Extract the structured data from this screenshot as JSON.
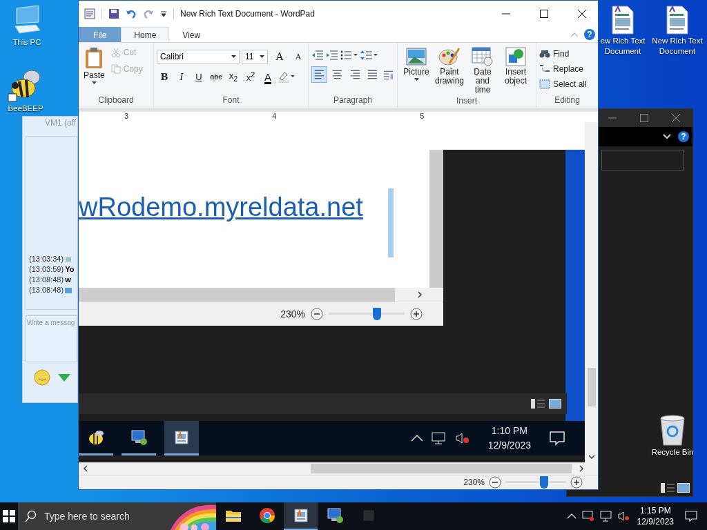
{
  "desktop": {
    "icons": [
      {
        "kind": "pc",
        "label": "This PC"
      },
      {
        "kind": "bee",
        "label": "BeeBEEP"
      },
      {
        "kind": "doc",
        "label": "ew Rich Text Document"
      },
      {
        "kind": "doc",
        "label": "New Rich Text Document"
      },
      {
        "kind": "bin",
        "label": "Recycle Bin"
      }
    ]
  },
  "chat_window": {
    "title": "VM1 (off",
    "messages": [
      {
        "kind": "icon",
        "time": "(13:03:34)"
      },
      {
        "kind": "text",
        "time": "(13:03:59)",
        "text": "Yo"
      },
      {
        "kind": "text",
        "time": "(13:08:48)",
        "text": "w"
      },
      {
        "kind": "mail",
        "time": "(13:08:48)"
      }
    ],
    "input": {
      "placeholder": "Write a messag"
    }
  },
  "explorer_window": {
    "help": "?"
  },
  "wordpad": {
    "title": "New Rich Text Document - WordPad",
    "help": "?",
    "tabs": [
      {
        "kind": "file",
        "label": "File",
        "selected": false
      },
      {
        "kind": "tab",
        "label": "Home",
        "selected": true
      },
      {
        "kind": "tab",
        "label": "View",
        "selected": false
      }
    ],
    "ribbon": {
      "clipboard": {
        "label": "Clipboard",
        "paste": "Paste",
        "items": [
          {
            "kind": "cut",
            "label": "Cut",
            "disabled": true
          },
          {
            "kind": "copy",
            "label": "Copy",
            "disabled": true
          }
        ]
      },
      "font": {
        "label": "Font",
        "family": "Calibri",
        "size": "11",
        "size_buttons": [
          {
            "kind": "grow",
            "label": "A"
          },
          {
            "kind": "shrink",
            "label": "A"
          }
        ],
        "format_buttons": [
          {
            "kind": "bold",
            "label": "B"
          },
          {
            "kind": "italic",
            "label": "I"
          },
          {
            "kind": "underline",
            "label": "U"
          },
          {
            "kind": "strike",
            "label": "abc"
          },
          {
            "kind": "sub",
            "label": "x$_{2}$"
          },
          {
            "kind": "sup",
            "label": "x$^{2}$"
          },
          {
            "kind": "color",
            "label": "A"
          },
          {
            "kind": "highlight"
          }
        ]
      },
      "paragraph": {
        "label": "Paragraph",
        "alignments": [
          {
            "kind": "left",
            "selected": true
          },
          {
            "kind": "center",
            "selected": false
          },
          {
            "kind": "right",
            "selected": false
          },
          {
            "kind": "justify",
            "selected": false
          }
        ]
      },
      "insert": {
        "label": "Insert",
        "items": [
          {
            "kind": "picture",
            "label": "Picture"
          },
          {
            "kind": "paint",
            "label": "Paint drawing"
          },
          {
            "kind": "datetime",
            "label": "Date and time"
          },
          {
            "kind": "object",
            "label": "Insert object"
          }
        ]
      },
      "editing": {
        "label": "Editing",
        "items": [
          {
            "kind": "find",
            "label": "Find"
          },
          {
            "kind": "replace",
            "label": "Replace"
          },
          {
            "kind": "select",
            "label": "Select all"
          }
        ]
      }
    },
    "ruler": [
      "3",
      "4",
      "5"
    ],
    "screenshot": {
      "link": "wRodemo.myreldata.net",
      "zoom": "230%",
      "level": 0.64,
      "taskbar": {
        "apps": [
          {
            "kind": "bee",
            "selected": false
          },
          {
            "kind": "remote",
            "selected": false
          },
          {
            "kind": "wordpad",
            "selected": true
          }
        ],
        "time": "1:10 PM",
        "date": "12/9/2023"
      }
    },
    "status_bar": {
      "zoom": "230%",
      "level": 0.64
    }
  },
  "taskbar": {
    "search": {
      "placeholder": "Type here to search"
    },
    "apps": [
      {
        "kind": "folder",
        "selected": false
      },
      {
        "kind": "chrome",
        "selected": false
      },
      {
        "kind": "wordpad",
        "selected": true
      },
      {
        "kind": "remote",
        "selected": false
      },
      {
        "kind": "app",
        "selected": false
      }
    ],
    "time": "1:15 PM",
    "date": "12/9/2023"
  }
}
